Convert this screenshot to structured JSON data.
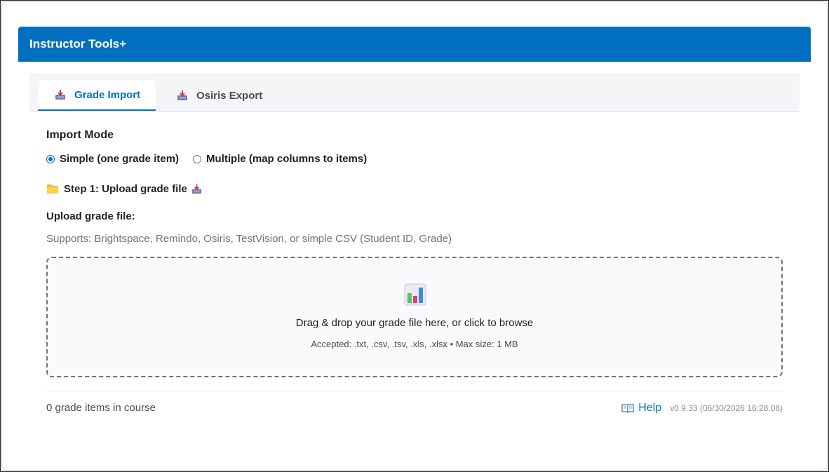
{
  "app": {
    "title": "Instructor Tools+"
  },
  "tabs": [
    {
      "label": "Grade Import",
      "icon": "inbox-tray-icon",
      "active": true
    },
    {
      "label": "Osiris Export",
      "icon": "inbox-tray-icon",
      "active": false
    }
  ],
  "import_mode": {
    "label": "Import Mode",
    "options": [
      {
        "label": "Simple (one grade item)",
        "selected": true
      },
      {
        "label": "Multiple (map columns to items)",
        "selected": false
      }
    ]
  },
  "step": {
    "title": "Step 1: Upload grade file",
    "icon": "folder-icon",
    "trailing_icon": "inbox-tray-icon"
  },
  "upload": {
    "label": "Upload grade file:",
    "supports": "Supports: Brightspace, Remindo, Osiris, TestVision, or simple CSV (Student ID, Grade)",
    "dropzone_text": "Drag & drop your grade file here, or click to browse",
    "accepted": "Accepted: .txt, .csv, .tsv, .xls, .xlsx • Max size: 1 MB",
    "icon": "bar-chart-icon"
  },
  "footer": {
    "grade_items": "0 grade items in course",
    "help": "Help",
    "version": "v0.9.33 (06/30/2026 16:28:08)"
  },
  "colors": {
    "accent": "#006fbf",
    "header_bg": "#006fbf"
  }
}
